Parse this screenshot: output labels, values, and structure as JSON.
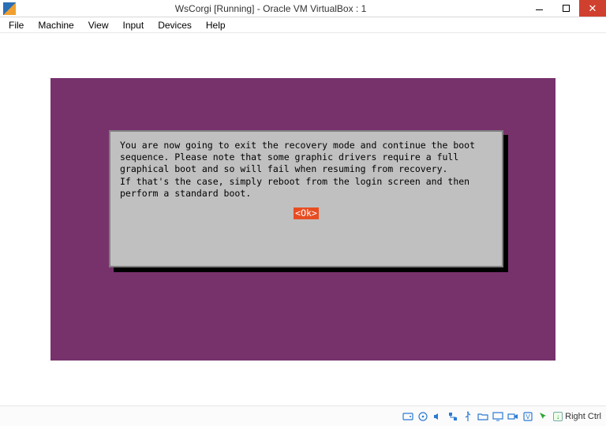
{
  "window": {
    "title": "WsCorgi [Running] - Oracle VM VirtualBox : 1"
  },
  "menu": {
    "items": [
      "File",
      "Machine",
      "View",
      "Input",
      "Devices",
      "Help"
    ]
  },
  "dialog": {
    "message": "You are now going to exit the recovery mode and continue the boot\nsequence. Please note that some graphic drivers require a full\ngraphical boot and so will fail when resuming from recovery.\nIf that's the case, simply reboot from the login screen and then\nperform a standard boot.",
    "ok_label": "<Ok>"
  },
  "status": {
    "icons": [
      {
        "name": "hard-disk-icon"
      },
      {
        "name": "optical-drive-icon"
      },
      {
        "name": "audio-icon"
      },
      {
        "name": "network-icon"
      },
      {
        "name": "usb-icon"
      },
      {
        "name": "shared-folder-icon"
      },
      {
        "name": "display-icon"
      },
      {
        "name": "recording-icon"
      },
      {
        "name": "virtualization-icon"
      },
      {
        "name": "mouse-integration-icon"
      }
    ],
    "host_key": "Right Ctrl"
  }
}
